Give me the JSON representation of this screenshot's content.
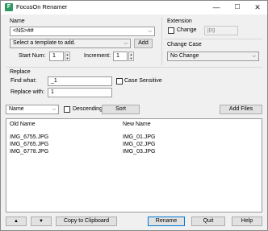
{
  "window": {
    "title": "FocusOn Renamer"
  },
  "name_section": {
    "label": "Name",
    "pattern": "<NS>##",
    "template_placeholder": "Select a template to add.",
    "add_button": "Add",
    "start_num_label": "Start Num:",
    "start_num": "1",
    "increment_label": "Increment:",
    "increment": "1"
  },
  "extension_section": {
    "label": "Extension",
    "change_label": "Change",
    "value": "jpg"
  },
  "change_case_section": {
    "label": "Change Case",
    "value": "No Change"
  },
  "replace_section": {
    "label": "Replace",
    "find_label": "Find what:",
    "find_value": "_1",
    "case_sensitive_label": "Case Sensitive",
    "replace_label": "Replace with:",
    "replace_value": "1"
  },
  "sort_bar": {
    "sort_by": "Name",
    "descending_label": "Descending",
    "sort_button": "Sort",
    "add_files_button": "Add Files"
  },
  "file_list": {
    "columns": [
      "Old Name",
      "New Name"
    ],
    "rows": [
      [
        "IMG_6755.JPG",
        "IMG_01.JPG"
      ],
      [
        "IMG_6765.JPG",
        "IMG_02.JPG"
      ],
      [
        "IMG_6778.JPG",
        "IMG_03.JPG"
      ]
    ]
  },
  "bottom_bar": {
    "up_icon": "▲",
    "down_icon": "▼",
    "copy_button": "Copy to Clipboard",
    "rename_button": "Rename",
    "quit_button": "Quit",
    "help_button": "Help"
  }
}
